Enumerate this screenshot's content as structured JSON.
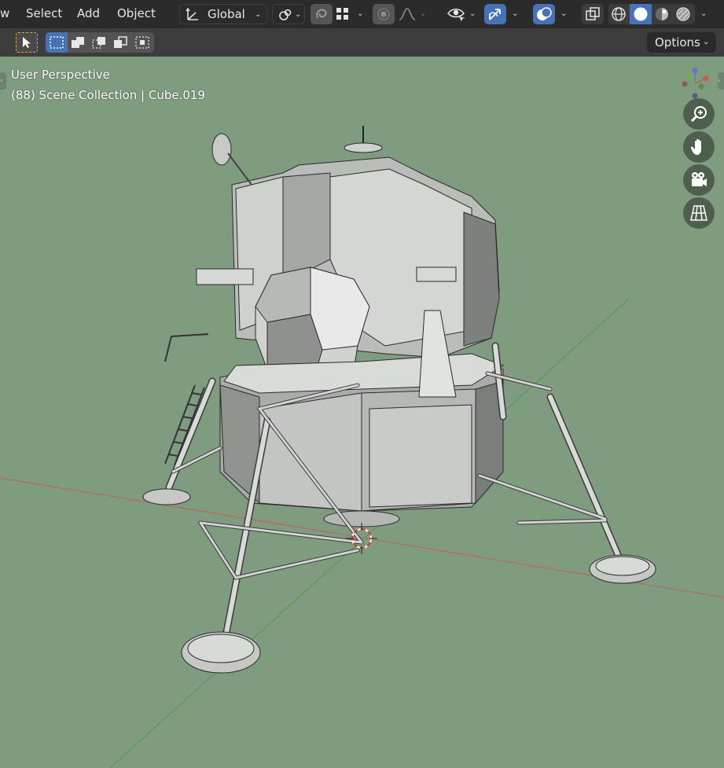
{
  "header": {
    "menu": [
      "w",
      "Select",
      "Add",
      "Object"
    ],
    "transform_orientation": "Global"
  },
  "toolbar": {
    "options_label": "Options"
  },
  "viewport": {
    "view_name": "User Perspective",
    "collection_info": "(88) Scene Collection | Cube.019"
  },
  "icons": [
    "orientation-icon",
    "link-icon",
    "snap-icon",
    "snap-grid-icon",
    "proportional-edit-icon",
    "falloff-icon",
    "visibility-icon",
    "gizmo-icon",
    "overlay-icon",
    "xray-icon",
    "wireframe-shading-icon",
    "solid-shading-icon",
    "material-shading-icon",
    "rendered-shading-icon",
    "select-tool-icon",
    "select-box-icon",
    "zoom-icon",
    "hand-icon",
    "camera-icon",
    "grid-icon",
    "navigation-gizmo"
  ],
  "colors": {
    "header_bg": "#2b2b2b",
    "toolbar_bg": "#3d3d3d",
    "viewport_bg": "#809c80",
    "active_blue": "#4772b3",
    "x_axis": "#c0584f",
    "y_axis": "#6ab04c"
  }
}
